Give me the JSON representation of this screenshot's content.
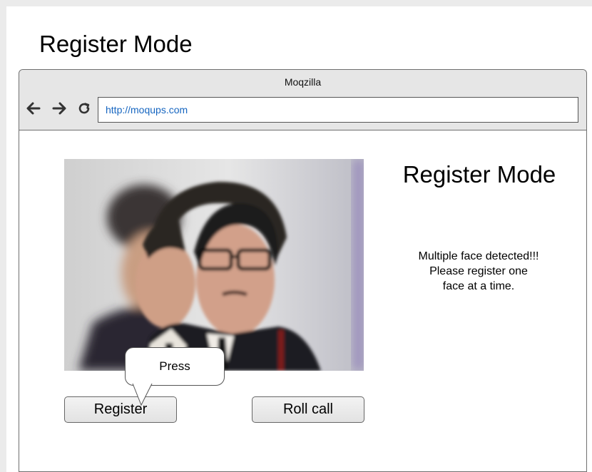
{
  "page": {
    "title": "Register Mode"
  },
  "browser": {
    "window_title": "Moqzilla",
    "url": "http://moqups.com",
    "nav_icons": [
      "arrow-left-icon",
      "arrow-right-icon",
      "reload-icon"
    ]
  },
  "content": {
    "heading": "Register Mode",
    "message_lines": [
      "Multiple face detected!!!",
      "Please register one",
      "face at a time."
    ],
    "callout_text": "Press",
    "register_label": "Register",
    "rollcall_label": "Roll call"
  },
  "colors": {
    "url_text": "#1565c0",
    "chrome_background": "#e6e6e6",
    "page_background": "#ebebeb"
  }
}
